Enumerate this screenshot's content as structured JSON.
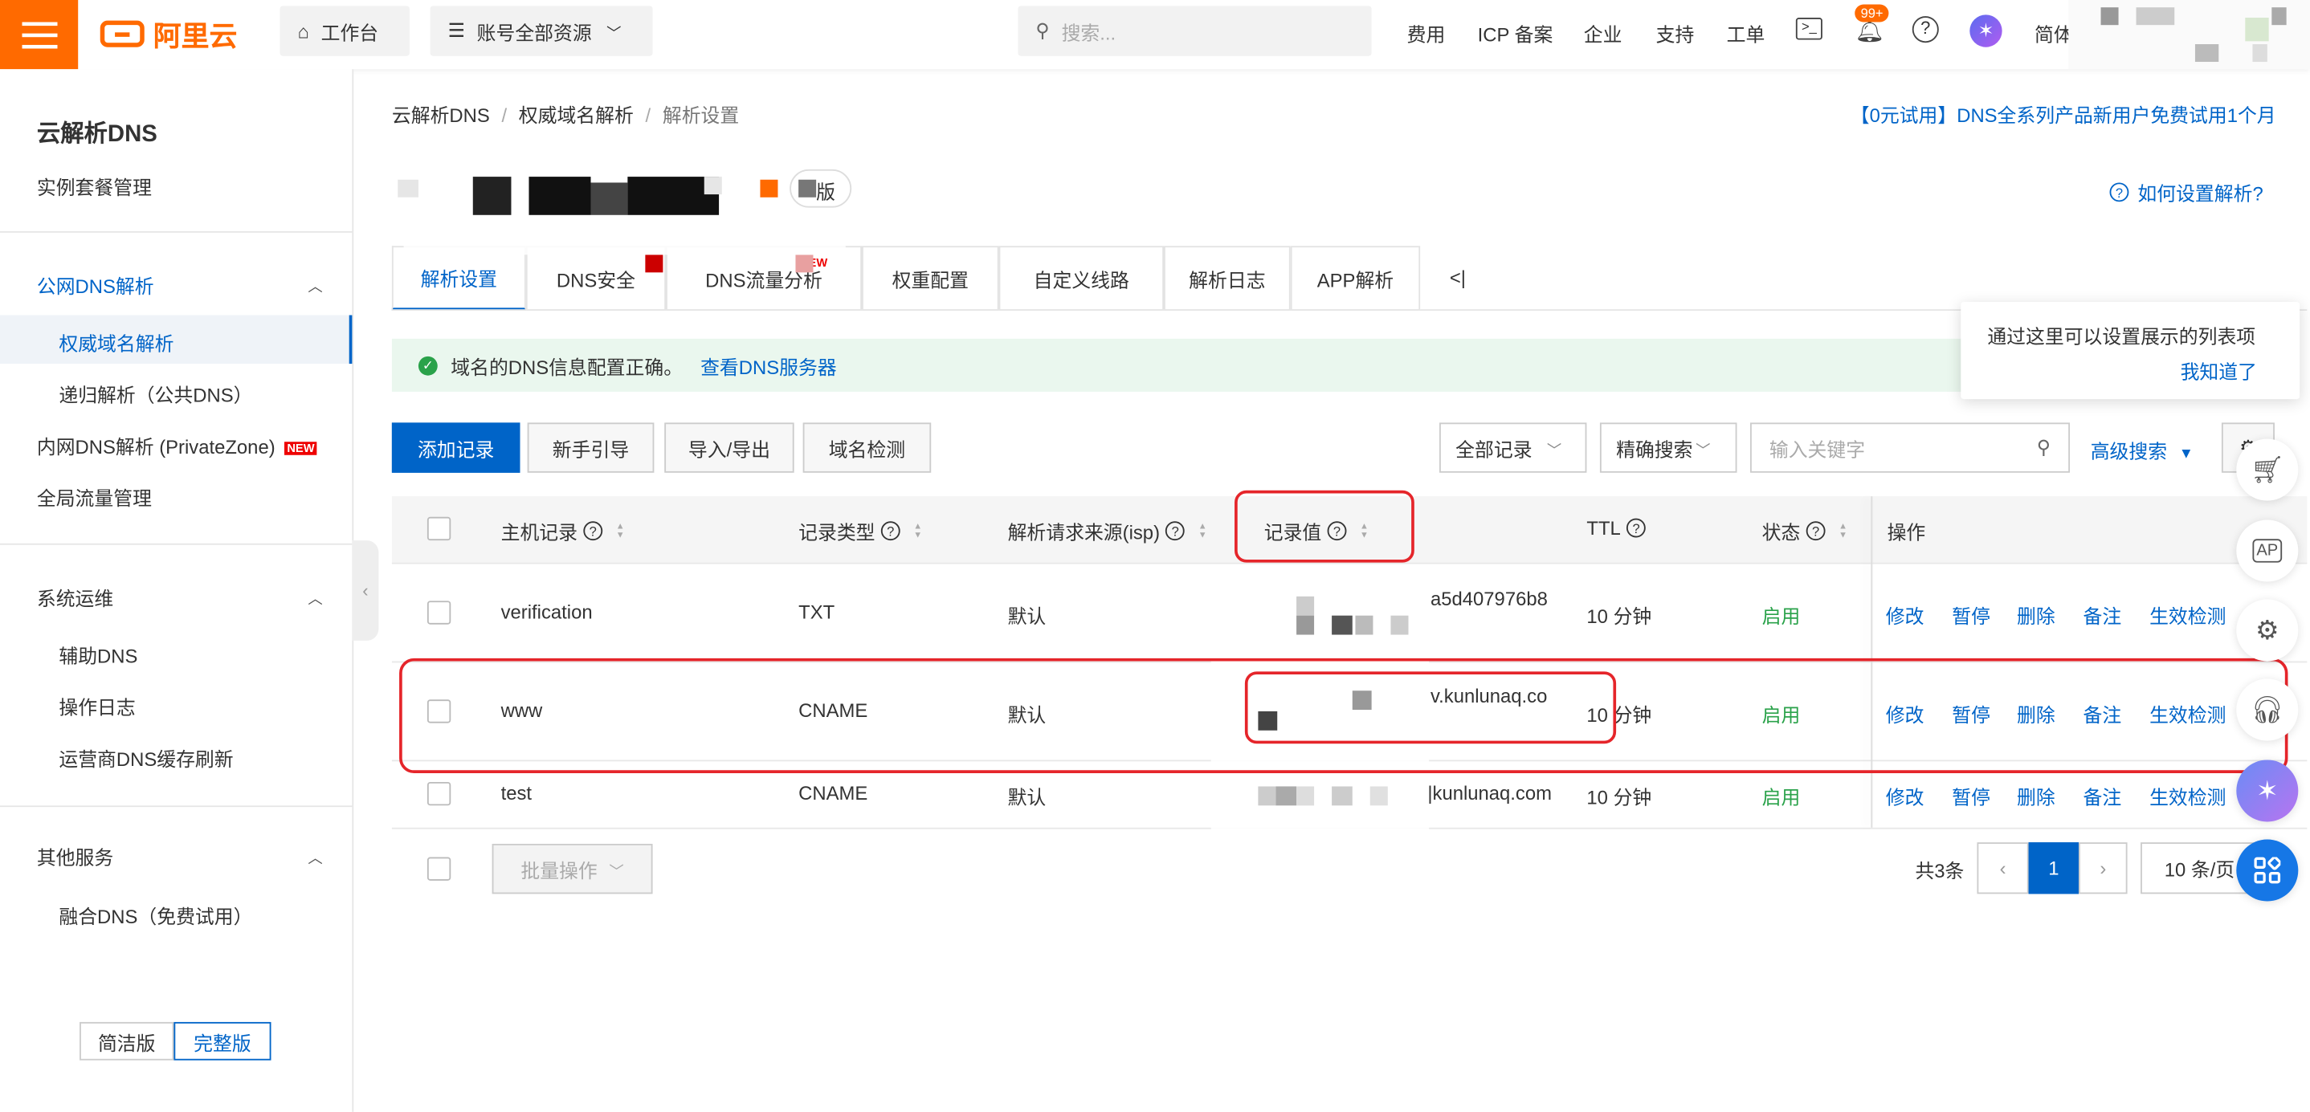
{
  "topbar": {
    "logo_text": "阿里云",
    "workbench": "工作台",
    "account_resources": "账号全部资源",
    "search_placeholder": "搜索...",
    "nav": [
      "费用",
      "ICP 备案",
      "企业",
      "支持",
      "工单"
    ],
    "notification_count": "99+",
    "lang": "简体"
  },
  "sidebar": {
    "title": "云解析DNS",
    "instance_mgmt": "实例套餐管理",
    "public_dns": "公网DNS解析",
    "authoritative": "权威域名解析",
    "recursive": "递归解析（公共DNS）",
    "private_zone": "内网DNS解析 (PrivateZone)",
    "new_badge": "NEW",
    "global_traffic": "全局流量管理",
    "sys_ops": "系统运维",
    "aux_dns": "辅助DNS",
    "op_log": "操作日志",
    "isp_refresh": "运营商DNS缓存刷新",
    "other": "其他服务",
    "fusion_dns": "融合DNS（免费试用）",
    "mode_simple": "简洁版",
    "mode_full": "完整版"
  },
  "breadcrumb": [
    "云解析DNS",
    "权威域名解析",
    "解析设置"
  ],
  "promo": "【0元试用】DNS全系列产品新用户免费试用1个月",
  "edition_suffix": "版",
  "howto": "如何设置解析?",
  "tabs": [
    "解析设置",
    "DNS安全",
    "DNS流量分析",
    "权重配置",
    "自定义线路",
    "解析日志",
    "APP解析"
  ],
  "tab_new_badge": "NEW",
  "tab_more": "<|",
  "alert": {
    "text": "域名的DNS信息配置正确。",
    "link": "查看DNS服务器"
  },
  "toolbar": {
    "add_record": "添加记录",
    "guide": "新手引导",
    "import_export": "导入/导出",
    "domain_check": "域名检测",
    "all_records": "全部记录",
    "exact_search": "精确搜索",
    "keyword_placeholder": "输入关键字",
    "advanced_search": "高级搜索"
  },
  "tooltip": {
    "text": "通过这里可以设置展示的列表项",
    "ack": "我知道了"
  },
  "table": {
    "headers": [
      "主机记录",
      "记录类型",
      "解析请求来源(isp)",
      "记录值",
      "TTL",
      "状态",
      "操作"
    ],
    "rows": [
      {
        "host": "verification",
        "type": "TXT",
        "isp": "默认",
        "value": "a5d407976b8",
        "ttl": "10 分钟",
        "status": "启用"
      },
      {
        "host": "www",
        "type": "CNAME",
        "isp": "默认",
        "value": "v.kunlunaq.co",
        "ttl": "10 分钟",
        "status": "启用"
      },
      {
        "host": "test",
        "type": "CNAME",
        "isp": "默认",
        "value": "|kunlunaq.com",
        "ttl": "10 分钟",
        "status": "启用"
      }
    ],
    "actions": [
      "修改",
      "暂停",
      "删除",
      "备注",
      "生效检测"
    ]
  },
  "footer": {
    "batch": "批量操作",
    "total": "共3条",
    "page": "1",
    "page_size": "10 条/页"
  },
  "colors": {
    "accent": "#0064c8",
    "brand": "#ff6a00",
    "highlight": "#e5252a",
    "status_ok": "#2aa24a"
  }
}
